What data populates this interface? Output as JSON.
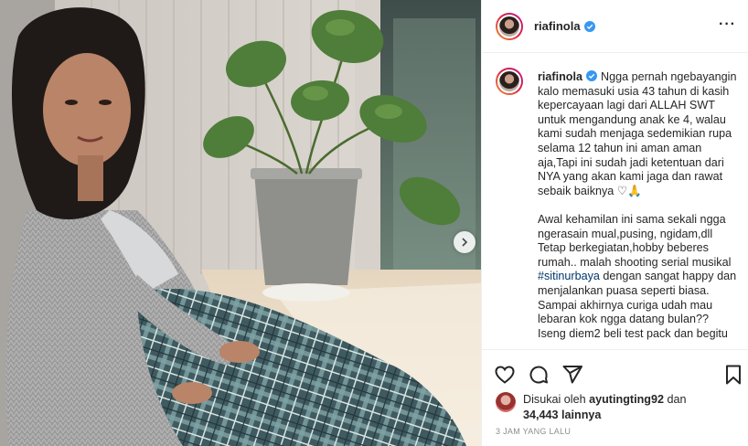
{
  "post": {
    "username": "riafinola",
    "verified": true,
    "photo_alt": "",
    "caption_username": "riafinola",
    "caption_paragraph1": "Ngga pernah ngebayangin kalo memasuki usia 43 tahun di kasih kepercayaan lagi dari ALLAH SWT untuk mengandung anak ke 4, walau kami sudah menjaga sedemikian rupa selama 12 tahun ini aman aman aja,Tapi ini sudah jadi ketentuan dari NYA yang akan kami jaga dan rawat sebaik baiknya ♡🙏",
    "caption_paragraph2_lines": [
      "Awal kehamilan ini sama sekali ngga ngerasain mual,pusing, ngidam,dll",
      "Tetap berkegiatan,hobby beberes rumah.. malah shooting serial musikal"
    ],
    "hashtag": "#sitinurbaya",
    "caption_paragraph2_after_hashtag": "dengan sangat happy dan menjalankan puasa seperti biasa.",
    "caption_paragraph2_tail": "Sampai akhirnya curiga udah mau lebaran kok ngga datang bulan?? Iseng diem2 beli test pack dan begitu"
  },
  "likes": {
    "prefix": "Disukai oleh",
    "user": "ayutingting92",
    "joiner": "dan",
    "count": "34,443 lainnya"
  },
  "timestamp": "3 JAM YANG LALU",
  "icons": {
    "like": "heart-icon",
    "comment": "comment-icon",
    "share": "paper-plane-icon",
    "save": "bookmark-icon",
    "next": "chevron-right-icon",
    "verified": "verified-badge-icon",
    "more": "more-options-icon"
  },
  "colors": {
    "link": "#00376b",
    "verified": "#3897f0",
    "muted": "#8e8e8e",
    "border": "#efefef"
  }
}
